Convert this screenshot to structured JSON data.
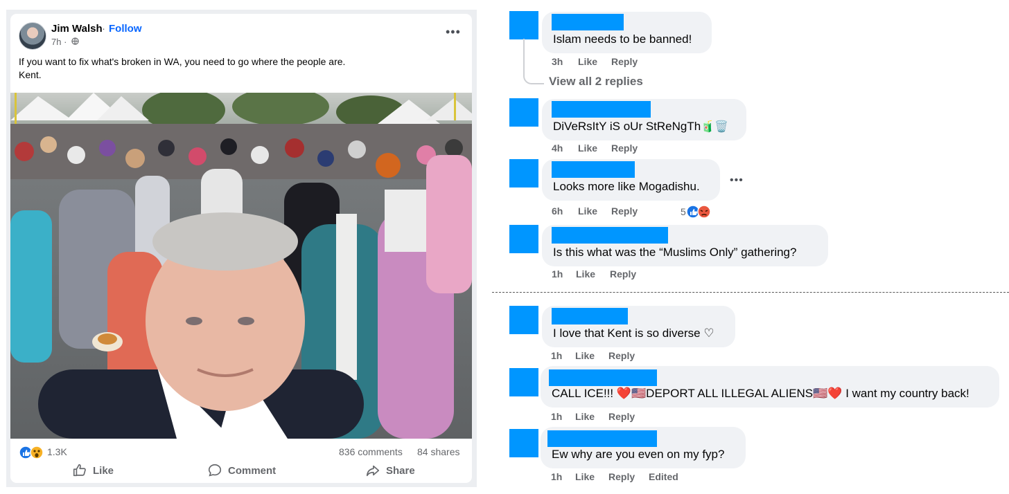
{
  "post": {
    "author": "Jim Walsh",
    "separator": "·",
    "follow": "Follow",
    "time": "7h ·",
    "text": "If you want to fix what's broken in WA, you need to go where the people are.\nKent.",
    "reaction_count": "1.3K",
    "comments_count": "836 comments",
    "shares_count": "84 shares",
    "actions": {
      "like": "Like",
      "comment": "Comment",
      "share": "Share"
    }
  },
  "comments": [
    {
      "text": "Islam needs to be banned!",
      "time": "3h",
      "like": "Like",
      "reply": "Reply"
    },
    {
      "text": "DiVeRsItY iS oUr StReNgTh",
      "emoji": "🧃🗑️",
      "time": "4h",
      "like": "Like",
      "reply": "Reply"
    },
    {
      "text": "Looks more like Mogadishu.",
      "time": "6h",
      "like": "Like",
      "reply": "Reply",
      "reactions": "5"
    },
    {
      "text": "Is this what was the “Muslims Only” gathering?",
      "time": "1h",
      "like": "Like",
      "reply": "Reply"
    },
    {
      "text": "I love that Kent is so diverse ♡",
      "time": "1h",
      "like": "Like",
      "reply": "Reply"
    },
    {
      "text": "CALL ICE!!! ❤️🇺🇸DEPORT ALL ILLEGAL ALIENS🇺🇸❤️ I want my country back!",
      "time": "1h",
      "like": "Like",
      "reply": "Reply"
    },
    {
      "text": "Ew why are you even on my fyp?",
      "time": "1h",
      "like": "Like",
      "reply": "Reply",
      "edited": "Edited"
    }
  ],
  "view_replies": "View all 2 replies",
  "colors": {
    "redaction": "#0096ff",
    "link": "#0866ff",
    "bubble": "#f0f2f5"
  }
}
